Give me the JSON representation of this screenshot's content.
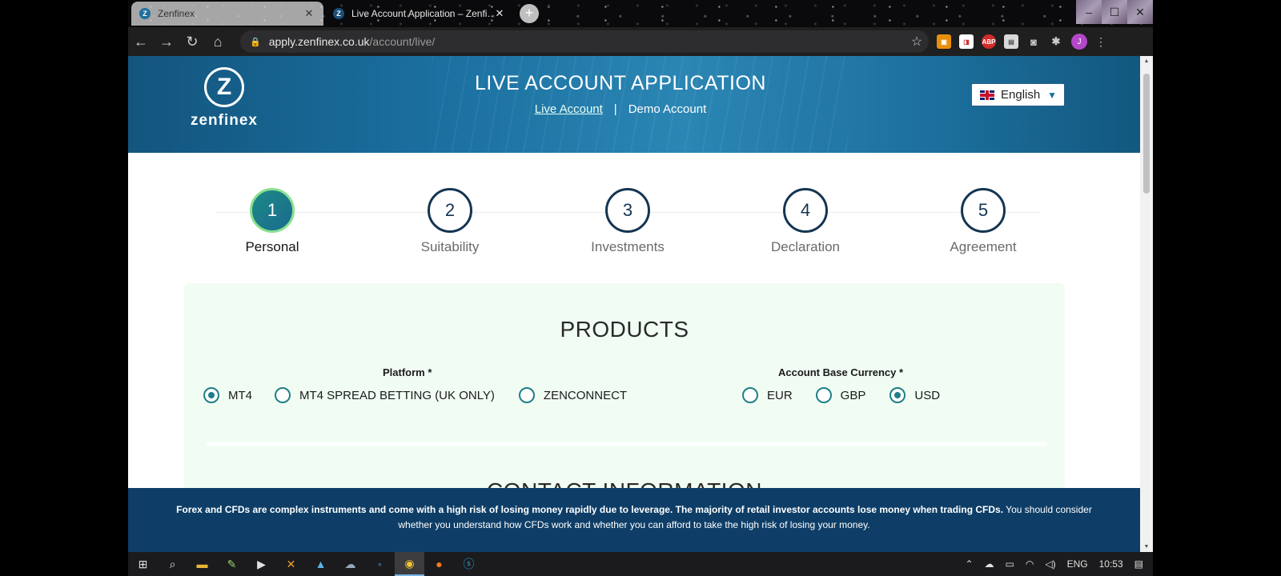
{
  "browser": {
    "tabs": [
      {
        "title": "Zenfinex",
        "favicon": "Z",
        "close": "✕"
      },
      {
        "title": "Live Account Application – Zenfi…",
        "favicon": "Z",
        "close": "✕"
      }
    ],
    "new_tab": "+",
    "url_host": "apply.zenfinex.co.uk",
    "url_path": "/account/live/",
    "extensions": [
      "ABP"
    ],
    "profile_initial": "J"
  },
  "header": {
    "logo_letter": "Z",
    "logo_word": "zenfinex",
    "title": "LIVE ACCOUNT APPLICATION",
    "links": {
      "live": "Live Account",
      "separator": "|",
      "demo": "Demo Account"
    },
    "language": "English"
  },
  "steps": [
    {
      "num": "1",
      "label": "Personal",
      "active": true
    },
    {
      "num": "2",
      "label": "Suitability",
      "active": false
    },
    {
      "num": "3",
      "label": "Investments",
      "active": false
    },
    {
      "num": "4",
      "label": "Declaration",
      "active": false
    },
    {
      "num": "5",
      "label": "Agreement",
      "active": false
    }
  ],
  "products": {
    "title": "PRODUCTS",
    "platform": {
      "label": "Platform *",
      "options": [
        "MT4",
        "MT4 SPREAD BETTING (UK ONLY)",
        "ZENCONNECT"
      ],
      "selected": "MT4"
    },
    "currency": {
      "label": "Account Base Currency *",
      "options": [
        "EUR",
        "GBP",
        "USD"
      ],
      "selected": "USD"
    }
  },
  "contact": {
    "title": "CONTACT INFORMATION"
  },
  "risk": {
    "bold": "Forex and CFDs are complex instruments and come with a high risk of losing money rapidly due to leverage. The majority of retail investor accounts lose money when trading CFDs.",
    "normal": " You should consider whether you understand how CFDs work and whether you can afford to take the high risk of losing your money."
  },
  "taskbar": {
    "language": "ENG",
    "time": "10:53"
  }
}
